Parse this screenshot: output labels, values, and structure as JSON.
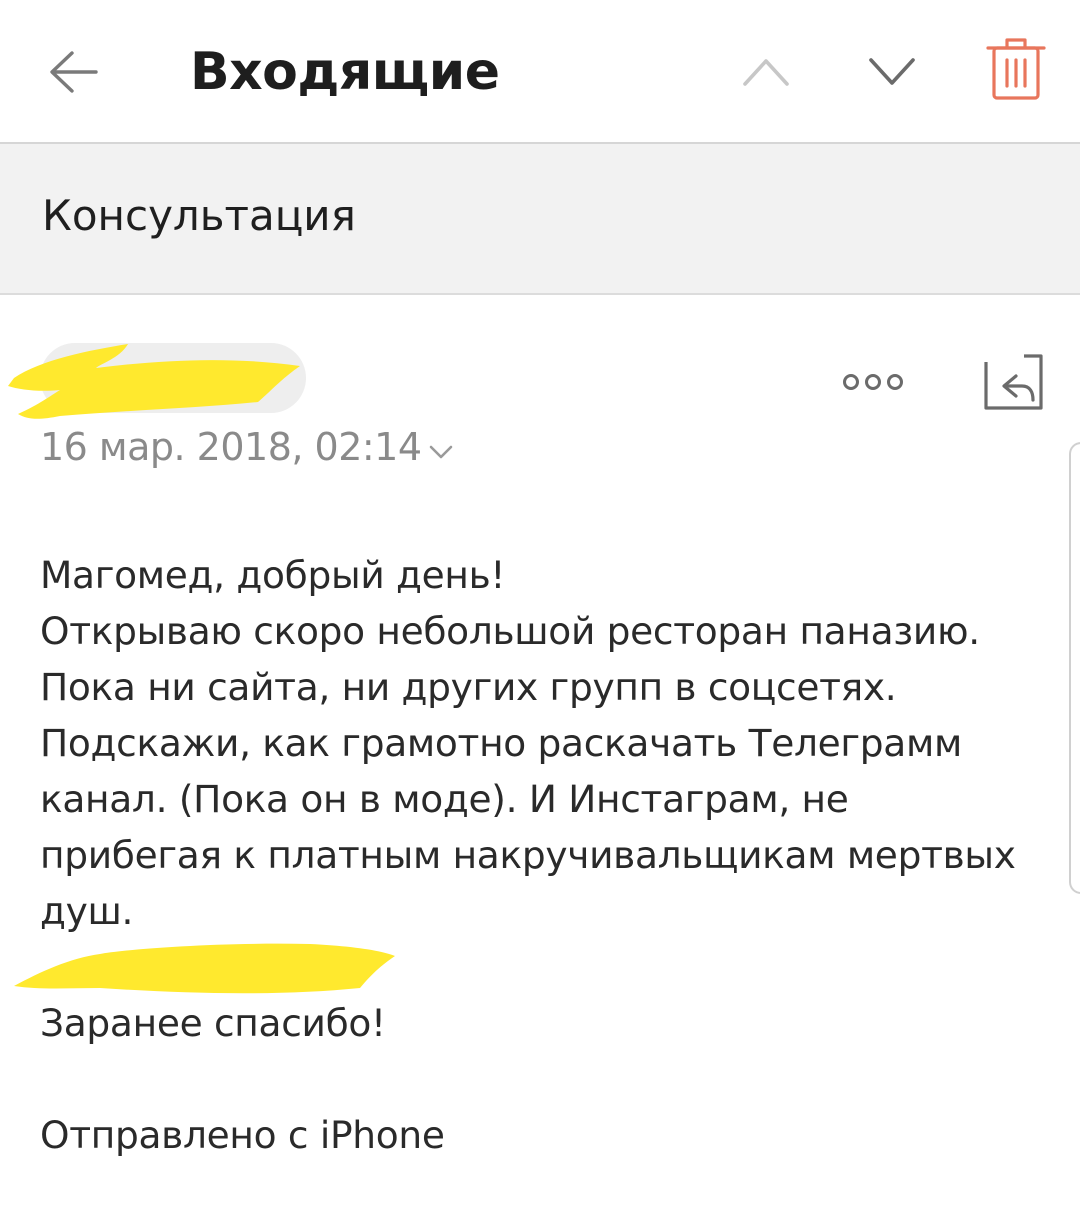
{
  "header": {
    "title": "Входящие"
  },
  "message": {
    "subject": "Консультация",
    "date": "16 мар. 2018, 02:14",
    "body_lines": [
      "Магомед, добрый день!",
      "Открываю скоро небольшой ресторан паназию.",
      "Пока ни сайта, ни других групп в соцсетях.",
      "Подскажи, как грамотно раскачать Телеграмм",
      "канал. (Пока он в моде). И Инстаграм, не",
      "прибегая к платным накручивальщикам мертвых",
      "душ."
    ],
    "closing": "Заранее спасибо!",
    "signature": "Отправлено с iPhone"
  },
  "icons": {
    "back": "arrow-left-icon",
    "up": "chevron-up-icon",
    "down": "chevron-down-icon",
    "trash": "trash-icon",
    "more": "more-icon",
    "reply": "reply-icon",
    "date_expand": "chevron-down-icon"
  },
  "colors": {
    "trash": "#e8765c",
    "icon": "#6b6b6b",
    "subject_bg": "#f2f2f2",
    "date_text": "#8a8a8a",
    "redaction": "#ffe92e"
  }
}
